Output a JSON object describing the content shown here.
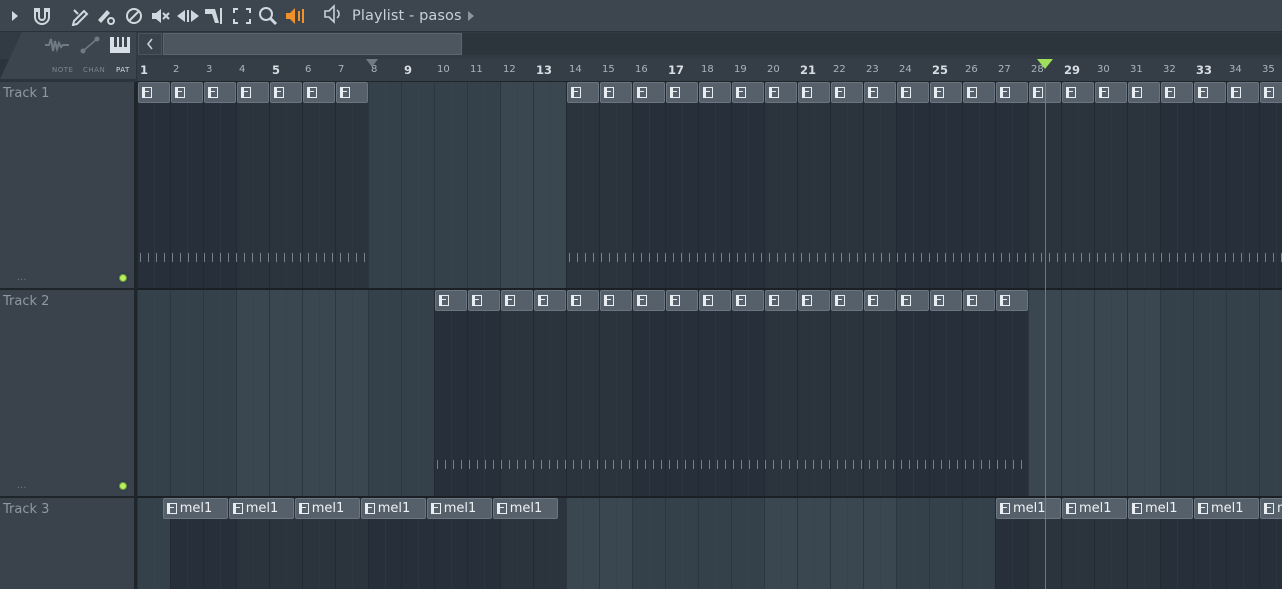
{
  "toolbar": {
    "icons": [
      "play-arrow-icon",
      "magnet-icon",
      "pencil-icon",
      "paint-brush-icon",
      "mute-circle-icon",
      "mute-speaker-icon",
      "slip-icon",
      "slice-icon",
      "select-icon",
      "zoom-icon",
      "playback-speaker-icon"
    ],
    "title": "Playlist - pasos",
    "accent_color": "#f0922b"
  },
  "modes": [
    {
      "label": "NOTE",
      "active": false
    },
    {
      "label": "CHAN",
      "active": false
    },
    {
      "label": "PAT",
      "active": true
    }
  ],
  "ruler": {
    "bars": [
      "1",
      "2",
      "3",
      "4",
      "5",
      "6",
      "7",
      "8",
      "9",
      "10",
      "11",
      "12",
      "13",
      "14",
      "15",
      "16",
      "17",
      "18",
      "19",
      "20",
      "21",
      "22",
      "23",
      "24",
      "25",
      "26",
      "27",
      "28",
      "29",
      "30",
      "31",
      "32",
      "33",
      "34",
      "35"
    ]
  },
  "tracks": [
    {
      "name": "Track 1",
      "dots": "..."
    },
    {
      "name": "Track 2",
      "dots": "..."
    },
    {
      "name": "Track 3",
      "dots": ""
    }
  ],
  "clips": {
    "track1": {
      "label": "",
      "start_bars": [
        1,
        2,
        3,
        4,
        5,
        6,
        7,
        14,
        15,
        16,
        17,
        18,
        19,
        20,
        21,
        22,
        23,
        24,
        25,
        26,
        27,
        28,
        29,
        30,
        31,
        32,
        33,
        34,
        35
      ]
    },
    "track2": {
      "label": "",
      "start_bars": [
        10,
        11,
        12,
        13,
        14,
        15,
        16,
        17,
        18,
        19,
        20,
        21,
        22,
        23,
        24,
        25,
        26,
        27
      ]
    },
    "track3": {
      "label": "mel1",
      "start_bars": [
        1.75,
        3.75,
        5.75,
        7.75,
        9.75,
        11.75,
        27,
        29,
        31,
        33,
        35
      ]
    }
  },
  "playhead_bar": 28.5,
  "colors": {
    "playhead": "#9ee05a",
    "track_led": "#b6f05d",
    "clip": "#56606a"
  }
}
